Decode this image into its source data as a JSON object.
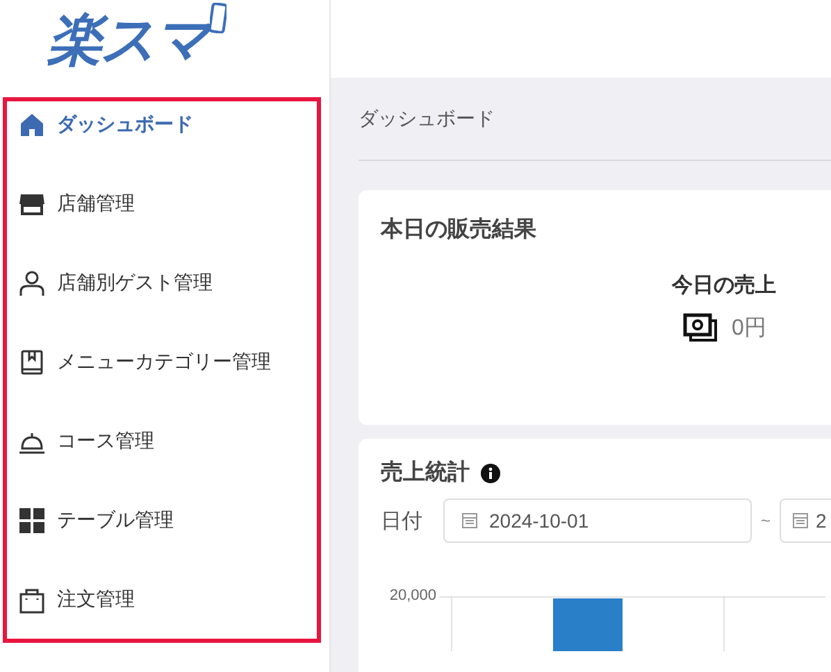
{
  "logo": {
    "text": "楽スマ"
  },
  "sidebar": {
    "items": [
      {
        "label": "ダッシュボード",
        "selected": true
      },
      {
        "label": "店舗管理",
        "selected": false
      },
      {
        "label": "店舗別ゲスト管理",
        "selected": false
      },
      {
        "label": "メニューカテゴリー管理",
        "selected": false
      },
      {
        "label": "コース管理",
        "selected": false
      },
      {
        "label": "テーブル管理",
        "selected": false
      },
      {
        "label": "注文管理",
        "selected": false
      }
    ]
  },
  "breadcrumb": "ダッシュボード",
  "today_card": {
    "title": "本日の販売結果",
    "metric_label": "今日の売上",
    "metric_value": "0円"
  },
  "stats_card": {
    "title": "売上統計",
    "date_label": "日付",
    "date_from": "2024-10-01",
    "separator": "~",
    "date_to": "2",
    "y_tick": "20,000"
  }
}
